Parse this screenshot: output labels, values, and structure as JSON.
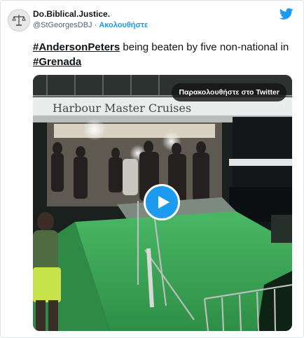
{
  "author": {
    "name": "Do.Biblical.Justice.",
    "handle": "@StGeorgesDBJ",
    "separator": "·",
    "follow_label": "Ακολουθήστε"
  },
  "tweet": {
    "hashtag_1": "#AndersonPeters",
    "text_middle": " being beaten by five non-national in ",
    "hashtag_2": "#Grenada"
  },
  "video": {
    "watch_label": "Παρακολουθήστε στο Twitter",
    "boat_sign": "Harbour Master Cruises"
  },
  "colors": {
    "accent": "#1d9bf0",
    "text": "#0f1419",
    "secondary_text": "#536471",
    "deck_green": "#3fa85a"
  },
  "icons": {
    "brand": "twitter-bird-icon",
    "play": "play-icon",
    "avatar": "scales-of-justice-icon"
  }
}
